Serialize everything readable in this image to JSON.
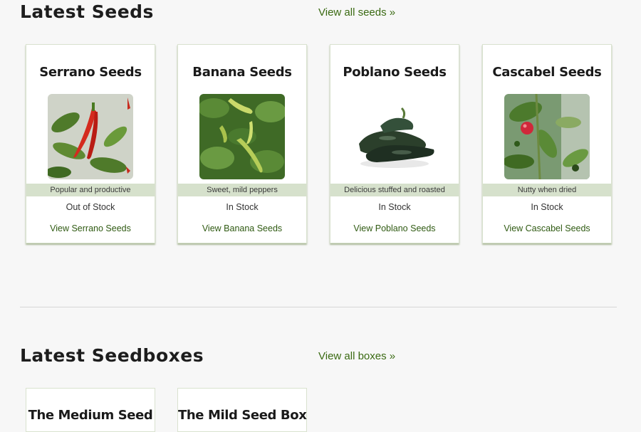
{
  "seeds_section": {
    "title": "Latest Seeds",
    "view_all": "View all seeds »",
    "cards": [
      {
        "title": "Serrano Seeds",
        "tagline": "Popular and productive",
        "stock": "Out of Stock",
        "link": "View Serrano Seeds"
      },
      {
        "title": "Banana Seeds",
        "tagline": "Sweet, mild peppers",
        "stock": "In Stock",
        "link": "View Banana Seeds"
      },
      {
        "title": "Poblano Seeds",
        "tagline": "Delicious stuffed and roasted",
        "stock": "In Stock",
        "link": "View Poblano Seeds"
      },
      {
        "title": "Cascabel Seeds",
        "tagline": "Nutty when dried",
        "stock": "In Stock",
        "link": "View Cascabel Seeds"
      }
    ]
  },
  "boxes_section": {
    "title": "Latest Seedboxes",
    "view_all": "View all boxes »",
    "cards": [
      {
        "title": "The Medium Seed"
      },
      {
        "title": "The Mild Seed Box"
      }
    ]
  },
  "colors": {
    "accent": "#3a6a12",
    "tagline_bg": "#d6e1cc",
    "background": "#f7f7f7"
  }
}
